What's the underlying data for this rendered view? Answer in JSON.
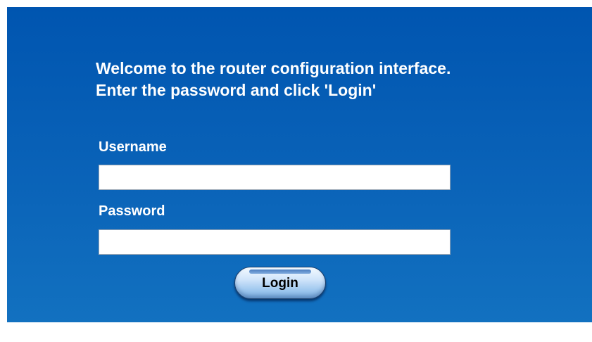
{
  "welcome": {
    "line1": "Welcome to the router configuration interface.",
    "line2": "Enter the password and click 'Login'"
  },
  "form": {
    "username_label": "Username",
    "username_value": "",
    "password_label": "Password",
    "password_value": "",
    "login_label": "Login"
  },
  "colors": {
    "background": "#0055b0",
    "text": "#ffffff",
    "button": "#9cc6ee"
  }
}
